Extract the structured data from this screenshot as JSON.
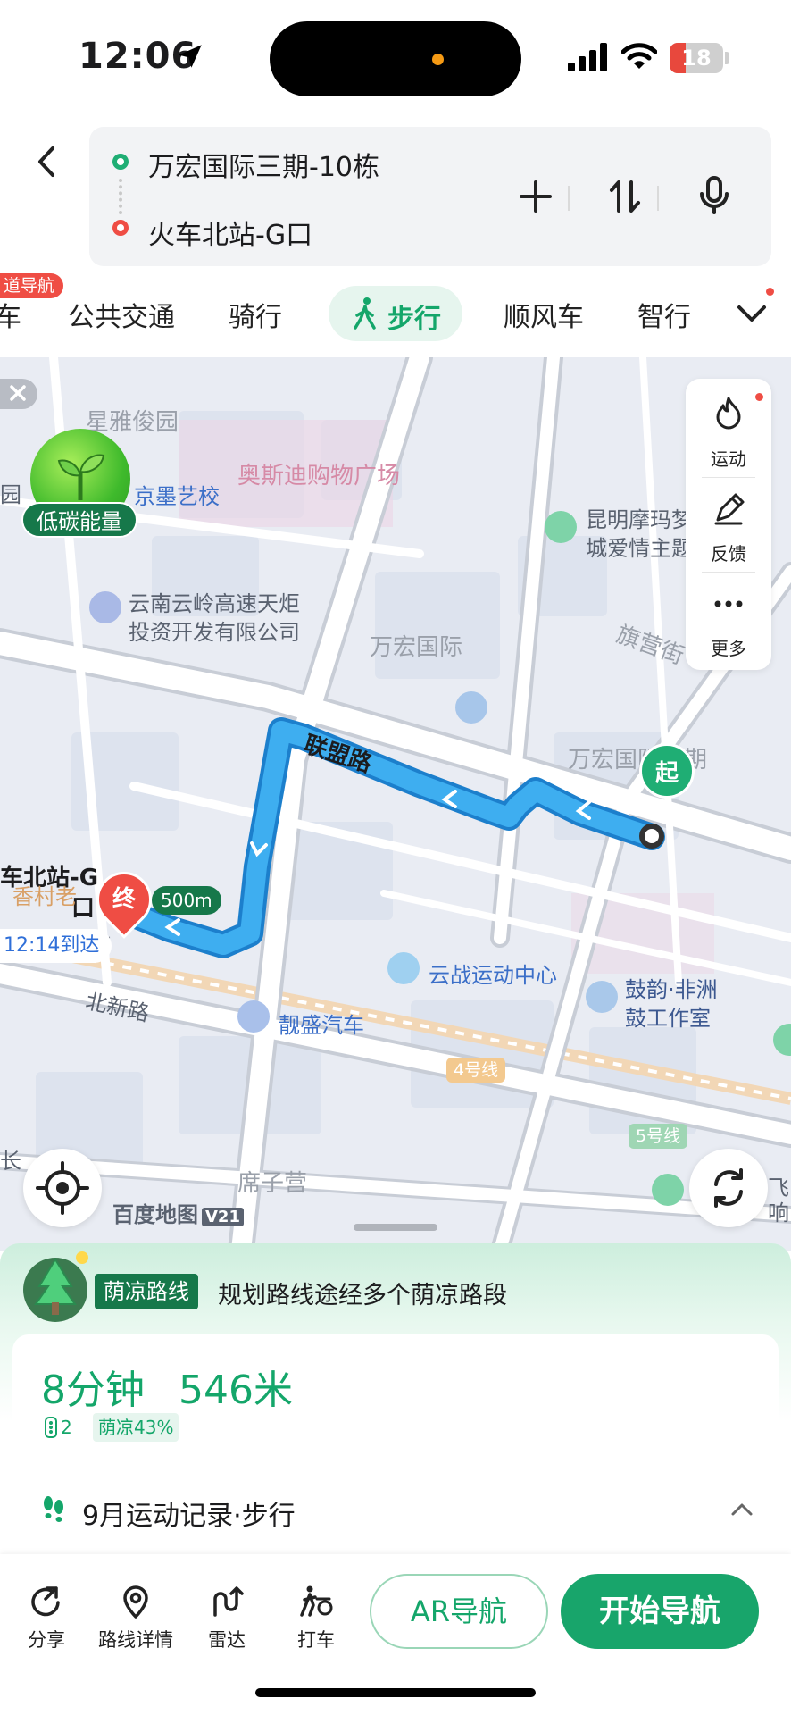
{
  "status_bar": {
    "time": "12:06",
    "battery": "18"
  },
  "route": {
    "start": "万宏国际三期-10栋",
    "end": "火车北站-G口"
  },
  "modes": {
    "badge": "道导航",
    "items": [
      "车",
      "公共交通",
      "骑行",
      "步行",
      "顺风车",
      "智行"
    ],
    "active": "步行"
  },
  "map": {
    "labels": {
      "xingya": "星雅俊园",
      "ostin": "奥斯迪购物广场",
      "jingmo": "京墨艺校",
      "yuan": "园",
      "kunming1": "昆明摩玛梦",
      "kunming2": "城爱情主题",
      "yunling1": "云南云岭高速天炬",
      "yunling2": "投资开发有限公司",
      "wanhong": "万宏国际",
      "qiying": "旗营街",
      "wanhong3": "万宏国际三期",
      "lianmeng": "联盟路",
      "station1": "车北站-G",
      "station2": "口",
      "xiangcun": "香村老",
      "zhan": "站",
      "yunzhan": "云战运动中心",
      "guyun1": "鼓韵·非洲",
      "guyun2": "鼓工作室",
      "beixin": "北新路",
      "jingsheng": "靓盛汽车",
      "line4": "4号线",
      "line5": "5号线",
      "xizi": "席子营",
      "chang": "长",
      "fei": "飞",
      "xiang": "响"
    },
    "start_marker": "起",
    "end_marker": "终",
    "distance_tag": "500m",
    "arrival": "12:14到达",
    "energy": "低碳能量",
    "side_tools": [
      "运动",
      "反馈",
      "更多"
    ],
    "brand": "百度地图",
    "brand_version": "V21"
  },
  "sheet": {
    "shade_tag": "荫凉路线",
    "shade_desc": "规划路线途经多个荫凉路段",
    "duration": "8分钟",
    "distance": "546米",
    "traffic_lights": "2",
    "shade_percent": "荫凉43%",
    "record": "9月运动记录·步行"
  },
  "actions": {
    "share": "分享",
    "details": "路线详情",
    "radar": "雷达",
    "taxi": "打车",
    "ar": "AR导航",
    "start_nav": "开始导航"
  },
  "colors": {
    "accent": "#18a56b",
    "route": "#2f9ce8",
    "end_red": "#ef4d44"
  }
}
